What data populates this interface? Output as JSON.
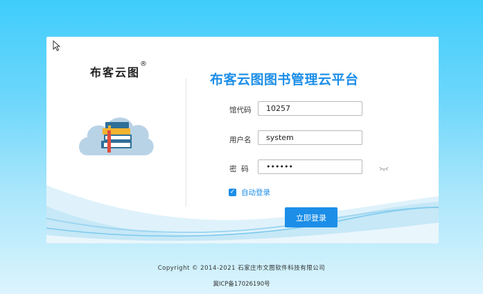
{
  "colors": {
    "accent": "#1c8ee8",
    "background_top": "#3fcdfb",
    "background_bottom": "#dcf4fd",
    "card": "#ffffff"
  },
  "brand": {
    "logo_text": "布客云图",
    "registered_mark": "®",
    "icon": "books-cloud-icon"
  },
  "login": {
    "title": "布客云图图书管理云平台",
    "fields": {
      "library_code": {
        "label": "馆代码",
        "value": "10257"
      },
      "username": {
        "label": "用户名",
        "value": "system"
      },
      "password": {
        "label": "密  码",
        "value": "••••••",
        "toggle_icon": "eye-closed-icon"
      }
    },
    "auto_login": {
      "label": "自动登录",
      "checked": true
    },
    "submit_label": "立即登录"
  },
  "footer": {
    "copyright": "Copyright © 2014-2021 石家庄市文图软件科技有限公司",
    "icp": "冀ICP备17026190号"
  }
}
